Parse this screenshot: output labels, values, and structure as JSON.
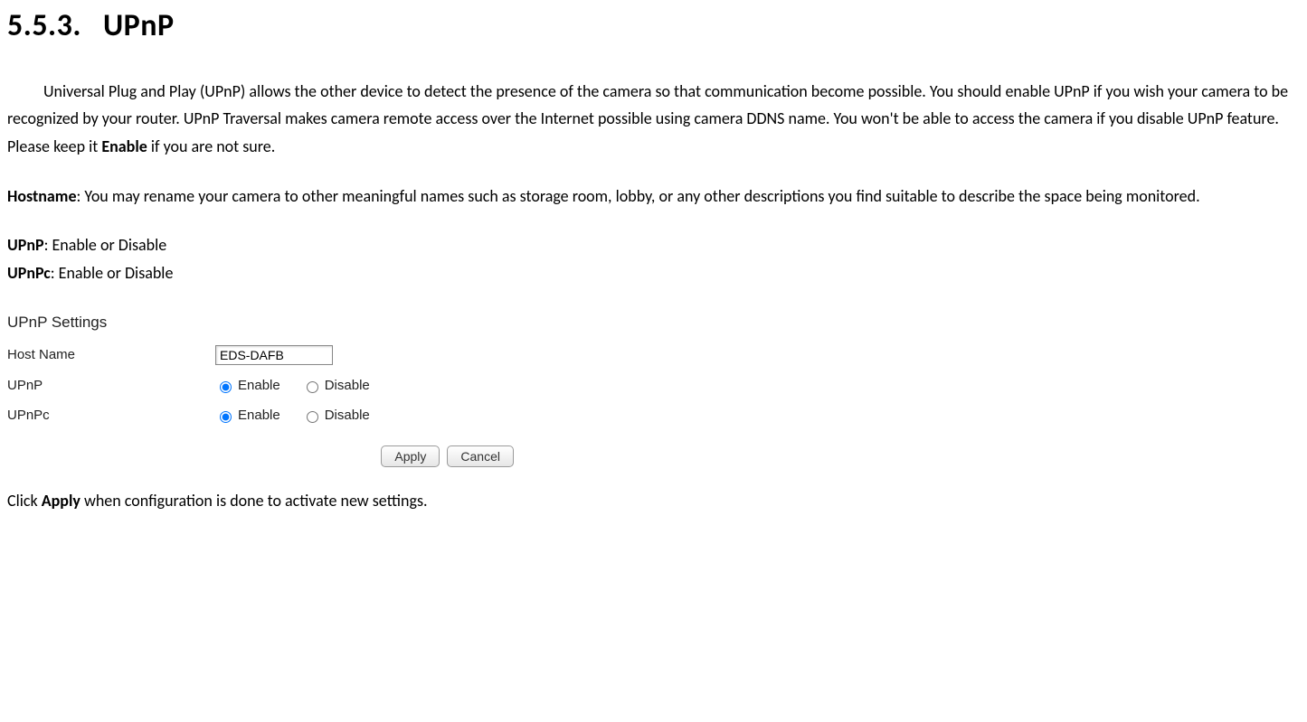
{
  "heading": {
    "number": "5.5.3.",
    "title": "UPnP"
  },
  "intro_before_bold": "Universal Plug and Play (UPnP) allows the other device to detect the presence of the camera so that communication become possible. You should enable UPnP if you wish your camera to be recognized by your router. UPnP Traversal makes camera remote access over the Internet possible using camera DDNS name. You won't be able to access the camera if you disable UPnP feature. Please keep it ",
  "intro_bold": "Enable",
  "intro_after_bold": " if you are not sure.",
  "hostname_label": "Hostname",
  "hostname_text": ": You may rename your camera to other meaningful names such as storage room, lobby, or any other descriptions you find suitable to describe the space being monitored.",
  "upnp_label": "UPnP",
  "upnp_text": ": Enable or Disable",
  "upnpc_label": "UPnPc",
  "upnpc_text": ": Enable or Disable",
  "panel": {
    "title": "UPnP Settings",
    "hostname_label": "Host Name",
    "hostname_value": "EDS-DAFB",
    "upnp_label": "UPnP",
    "upnpc_label": "UPnPc",
    "option_enable": "Enable",
    "option_disable": "Disable",
    "apply": "Apply",
    "cancel": "Cancel"
  },
  "footer_before": "Click ",
  "footer_bold": "Apply",
  "footer_after": " when configuration is done to activate new settings."
}
